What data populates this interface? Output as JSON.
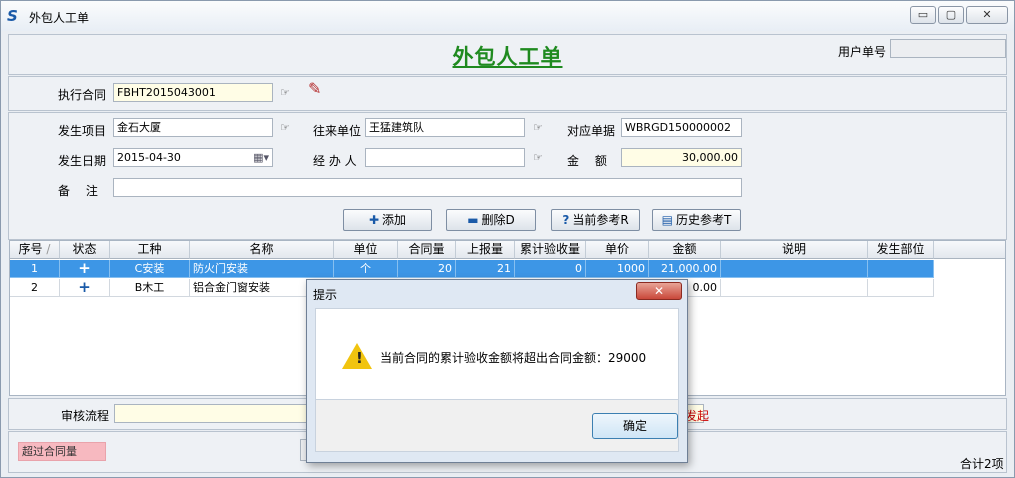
{
  "window": {
    "title": "外包人工单",
    "min": "▭",
    "restore": "▢",
    "close": "✕"
  },
  "form": {
    "title": "外包人工单",
    "user_no_label": "用户单号",
    "user_no_value": "",
    "contract_label": "执行合同",
    "contract_value": "FBHT2015043001",
    "project_label": "发生项目",
    "project_value": "金石大厦",
    "vendor_label": "往来单位",
    "vendor_value": "王猛建筑队",
    "ref_doc_label": "对应单据",
    "ref_doc_value": "WBRGD150000002",
    "date_label": "发生日期",
    "date_value": "2015-04-30",
    "handler_label": "经 办 人",
    "handler_value": "",
    "amount_label": "金　 额",
    "amount_value": "30,000.00",
    "remark_label": "备　 注",
    "remark_value": ""
  },
  "toolbar": {
    "add_label": "添加",
    "delete_label": "删除D",
    "current_ref_label": "当前参考R",
    "history_ref_label": "历史参考T"
  },
  "grid": {
    "columns": [
      "序号",
      "状态",
      "工种",
      "名称",
      "单位",
      "合同量",
      "上报量",
      "累计验收量",
      "单价",
      "金额",
      "说明",
      "发生部位"
    ],
    "rows": [
      {
        "no": "1",
        "status": "+",
        "type": "C安装",
        "name": "防火门安装",
        "unit": "个",
        "contract_qty": "20",
        "reported_qty": "21",
        "accepted_qty": "0",
        "price": "1000",
        "amount": "21,000.00",
        "note": "",
        "location": ""
      },
      {
        "no": "2",
        "status": "+",
        "type": "B木工",
        "name": "铝合金门窗安装",
        "unit": "",
        "contract_qty": "",
        "reported_qty": "",
        "accepted_qty": "",
        "price": "",
        "amount": "0.00",
        "note": "",
        "location": ""
      }
    ]
  },
  "footer": {
    "workflow_label": "审核流程",
    "workflow_status": "发起",
    "over_contract_badge": "超过合同量",
    "total_count": "合计2项"
  },
  "dialog": {
    "title": "提示",
    "message": "当前合同的累计验收金额将超出合同金额：29000",
    "ok_label": "确定",
    "close": "✕"
  },
  "colors": {
    "title_green": "#1f8a1f",
    "selection_blue": "#3d96e6",
    "warning_red": "#cc0000",
    "badge_pink": "#f7b9c0",
    "field_yellow": "#fffde6"
  }
}
